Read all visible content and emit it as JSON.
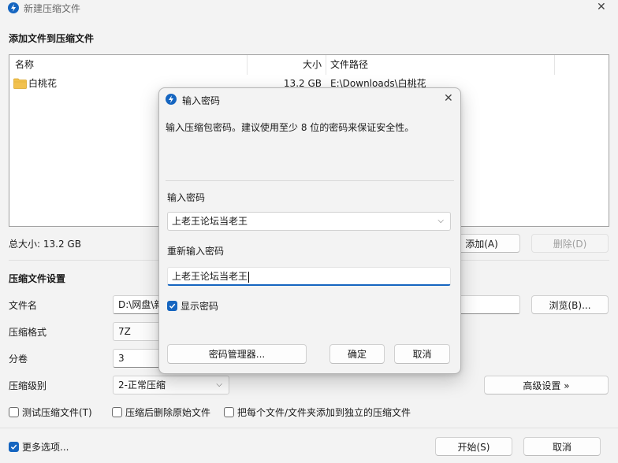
{
  "window": {
    "title": "新建压缩文件",
    "close_glyph": "✕",
    "app_icon": "bolt-icon"
  },
  "files_section": {
    "title": "添加文件到压缩文件",
    "columns": {
      "name": "名称",
      "size": "大小",
      "path": "文件路径"
    },
    "rows": [
      {
        "name": "白桃花",
        "size": "13.2 GB",
        "path": "E:\\Downloads\\白桃花",
        "icon": "folder-icon"
      }
    ],
    "total_label": "总大小: 13.2 GB",
    "add_button": "添加(A)",
    "remove_button": "删除(D)"
  },
  "settings": {
    "title": "压缩文件设置",
    "filename_label": "文件名",
    "filename_value": "D:\\网盘\\新",
    "browse_button": "浏览(B)...",
    "format_label": "压缩格式",
    "format_value": "7Z",
    "split_label": "分卷",
    "split_value": "3",
    "level_label": "压缩级别",
    "level_value": "2-正常压缩",
    "advanced_button": "高级设置 »",
    "options": {
      "test": "测试压缩文件(T)",
      "delete_after": "压缩后删除原始文件",
      "separate": "把每个文件/文件夹添加到独立的压缩文件"
    }
  },
  "footer": {
    "more_options": "更多选项...",
    "start_button": "开始(S)",
    "cancel_button": "取消"
  },
  "dialog": {
    "title": "输入密码",
    "message": "输入压缩包密码。建议使用至少 8 位的密码来保证安全性。",
    "password_label": "输入密码",
    "password_value": "上老王论坛当老王",
    "confirm_label": "重新输入密码",
    "confirm_value": "上老王论坛当老王",
    "show_password": "显示密码",
    "show_password_checked": true,
    "manager_button": "密码管理器...",
    "ok_button": "确定",
    "cancel_button": "取消",
    "close_glyph": "✕"
  },
  "colors": {
    "accent": "#1565c0",
    "folder": "#f2c14e"
  }
}
